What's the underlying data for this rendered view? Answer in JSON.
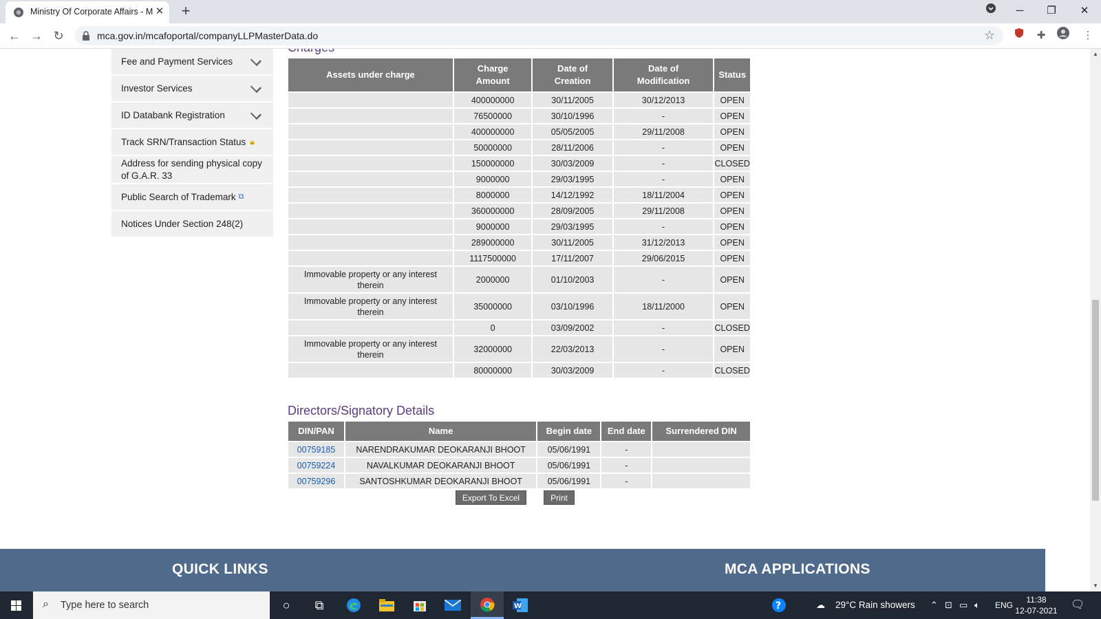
{
  "browser": {
    "tab_title": "Ministry Of Corporate Affairs - M",
    "url": "mca.gov.in/mcafoportal/companyLLPMasterData.do"
  },
  "sidebar": {
    "items": [
      {
        "label": "Fee and Payment Services",
        "icon": "chevron-down-icon"
      },
      {
        "label": "Investor Services",
        "icon": "chevron-down-icon"
      },
      {
        "label": "ID Databank Registration",
        "icon": "chevron-down-icon"
      },
      {
        "label": "Track SRN/Transaction Status",
        "icon": "lock-icon"
      },
      {
        "label": "Address for sending physical copy of G.A.R. 33",
        "icon": ""
      },
      {
        "label": "Public Search of Trademark",
        "icon": "external-link-icon"
      },
      {
        "label": "Notices Under Section 248(2)",
        "icon": ""
      }
    ]
  },
  "charges": {
    "title": "Charges",
    "headers": [
      "Assets under charge",
      "Charge Amount",
      "Date of Creation",
      "Date of Modification",
      "Status"
    ],
    "rows": [
      [
        "",
        "400000000",
        "30/11/2005",
        "30/12/2013",
        "OPEN"
      ],
      [
        "",
        "76500000",
        "30/10/1996",
        "-",
        "OPEN"
      ],
      [
        "",
        "400000000",
        "05/05/2005",
        "29/11/2008",
        "OPEN"
      ],
      [
        "",
        "50000000",
        "28/11/2006",
        "-",
        "OPEN"
      ],
      [
        "",
        "150000000",
        "30/03/2009",
        "-",
        "CLOSED"
      ],
      [
        "",
        "9000000",
        "29/03/1995",
        "-",
        "OPEN"
      ],
      [
        "",
        "8000000",
        "14/12/1992",
        "18/11/2004",
        "OPEN"
      ],
      [
        "",
        "360000000",
        "28/09/2005",
        "29/11/2008",
        "OPEN"
      ],
      [
        "",
        "9000000",
        "29/03/1995",
        "-",
        "OPEN"
      ],
      [
        "",
        "289000000",
        "30/11/2005",
        "31/12/2013",
        "OPEN"
      ],
      [
        "",
        "1117500000",
        "17/11/2007",
        "29/06/2015",
        "OPEN"
      ],
      [
        "Immovable property or any interest therein",
        "2000000",
        "01/10/2003",
        "-",
        "OPEN"
      ],
      [
        "Immovable property or any interest therein",
        "35000000",
        "03/10/1996",
        "18/11/2000",
        "OPEN"
      ],
      [
        "",
        "0",
        "03/09/2002",
        "-",
        "CLOSED"
      ],
      [
        "Immovable property or any interest therein",
        "32000000",
        "22/03/2013",
        "-",
        "OPEN"
      ],
      [
        "",
        "80000000",
        "30/03/2009",
        "-",
        "CLOSED"
      ]
    ]
  },
  "directors": {
    "title": "Directors/Signatory Details",
    "headers": [
      "DIN/PAN",
      "Name",
      "Begin date",
      "End date",
      "Surrendered DIN"
    ],
    "rows": [
      [
        "00759185",
        "NARENDRAKUMAR DEOKARANJI BHOOT",
        "05/06/1991",
        "-",
        ""
      ],
      [
        "00759224",
        "NAVALKUMAR DEOKARANJI BHOOT",
        "05/06/1991",
        "-",
        ""
      ],
      [
        "00759296",
        "SANTOSHKUMAR DEOKARANJI BHOOT",
        "05/06/1991",
        "-",
        ""
      ]
    ]
  },
  "actions": {
    "export_label": "Export To Excel",
    "print_label": "Print"
  },
  "footer": {
    "quick_links": "QUICK LINKS",
    "mca_apps": "MCA APPLICATIONS"
  },
  "taskbar": {
    "search_placeholder": "Type here to search",
    "weather": "29°C  Rain showers",
    "language": "ENG",
    "time": "11:38",
    "date": "12-07-2021"
  }
}
